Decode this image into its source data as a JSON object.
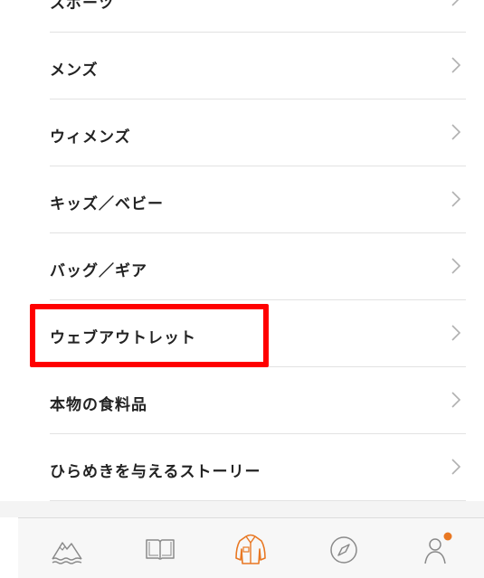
{
  "menu": {
    "items": [
      {
        "label": "スポーツ"
      },
      {
        "label": "メンズ"
      },
      {
        "label": "ウィメンズ"
      },
      {
        "label": "キッズ／ベビー"
      },
      {
        "label": "バッグ／ギア"
      },
      {
        "label": "ウェブアウトレット"
      },
      {
        "label": "本物の食料品"
      },
      {
        "label": "ひらめきを与えるストーリー"
      }
    ]
  },
  "highlight": {
    "color": "#ff0000"
  },
  "tabbar": {
    "tabs": [
      {
        "icon": "mountain-icon",
        "active": false
      },
      {
        "icon": "book-icon",
        "active": false
      },
      {
        "icon": "jacket-icon",
        "active": true
      },
      {
        "icon": "compass-icon",
        "active": false
      },
      {
        "icon": "profile-icon",
        "active": false,
        "badge": true
      }
    ],
    "accent_color": "#e87722",
    "icon_color": "#8a8a8a"
  }
}
